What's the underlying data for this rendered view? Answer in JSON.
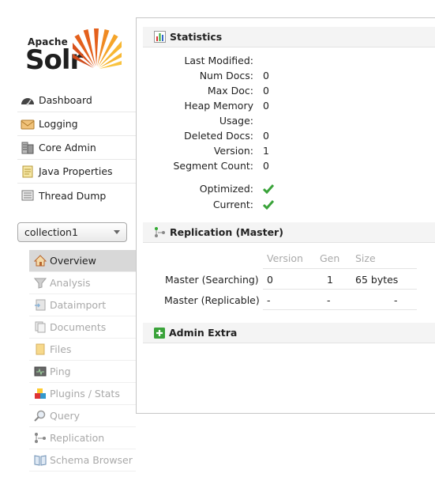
{
  "logo": {
    "apache": "Apache",
    "solr": "Solr"
  },
  "nav": {
    "items": [
      {
        "label": "Dashboard",
        "icon": "dashboard-icon"
      },
      {
        "label": "Logging",
        "icon": "logging-icon"
      },
      {
        "label": "Core Admin",
        "icon": "core-admin-icon"
      },
      {
        "label": "Java Properties",
        "icon": "java-properties-icon"
      },
      {
        "label": "Thread Dump",
        "icon": "thread-dump-icon"
      }
    ]
  },
  "core_selector": {
    "value": "collection1"
  },
  "core_nav": {
    "items": [
      {
        "label": "Overview",
        "icon": "home-icon",
        "active": true
      },
      {
        "label": "Analysis",
        "icon": "funnel-icon"
      },
      {
        "label": "Dataimport",
        "icon": "dataimport-icon"
      },
      {
        "label": "Documents",
        "icon": "documents-icon"
      },
      {
        "label": "Files",
        "icon": "files-icon"
      },
      {
        "label": "Ping",
        "icon": "ping-icon"
      },
      {
        "label": "Plugins / Stats",
        "icon": "plugins-icon"
      },
      {
        "label": "Query",
        "icon": "query-icon"
      },
      {
        "label": "Replication",
        "icon": "replication-icon"
      },
      {
        "label": "Schema Browser",
        "icon": "schema-browser-icon"
      }
    ]
  },
  "statistics": {
    "title": "Statistics",
    "rows": [
      {
        "label": "Last Modified:",
        "value": ""
      },
      {
        "label": "Num Docs:",
        "value": "0"
      },
      {
        "label": "Max Doc:",
        "value": "0"
      },
      {
        "label": "Heap Memory",
        "value": "0"
      },
      {
        "label": "Usage:",
        "value": ""
      },
      {
        "label": "Deleted Docs:",
        "value": "0"
      },
      {
        "label": "Version:",
        "value": "1"
      },
      {
        "label": "Segment Count:",
        "value": "0"
      }
    ],
    "flags": [
      {
        "label": "Optimized:",
        "icon": "check-icon"
      },
      {
        "label": "Current:",
        "icon": "check-icon"
      }
    ]
  },
  "replication": {
    "title": "Replication (Master)",
    "columns": [
      "Version",
      "Gen",
      "Size"
    ],
    "rows": [
      {
        "label": "Master (Searching)",
        "version": "0",
        "gen": "1",
        "size": "65 bytes"
      },
      {
        "label": "Master (Replicable)",
        "version": "-",
        "gen": "-",
        "size": "-"
      }
    ]
  },
  "admin_extra": {
    "title": "Admin Extra"
  },
  "colors": {
    "check": "#3aa33a",
    "active_bg": "#d8d8d8",
    "muted_text": "#a9a9a9",
    "panel_head_bg": "#f4f4f4"
  }
}
